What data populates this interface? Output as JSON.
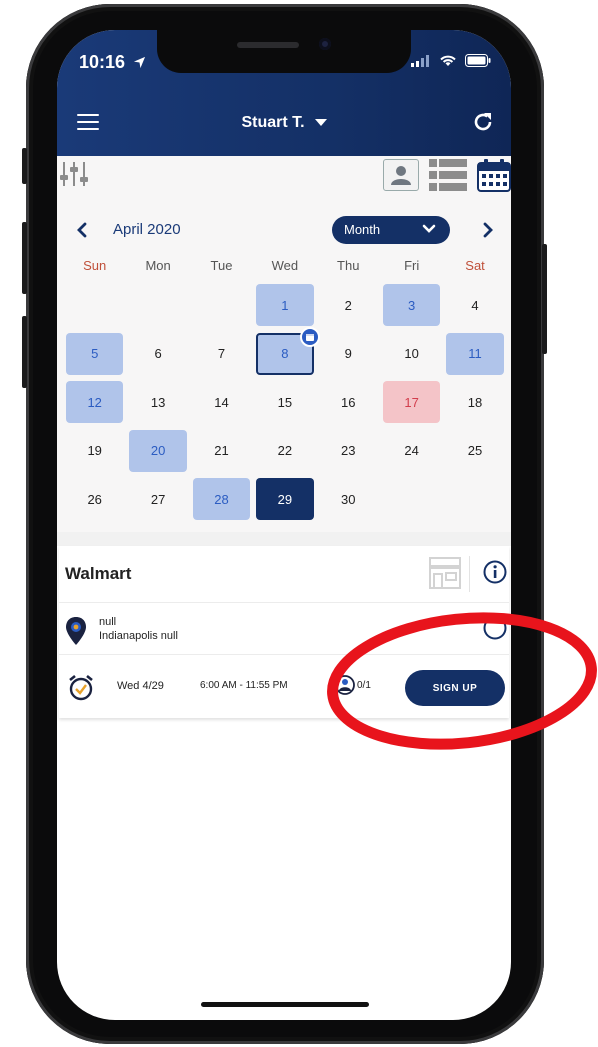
{
  "status_bar": {
    "time": "10:16"
  },
  "header": {
    "user_name": "Stuart T."
  },
  "calendar": {
    "month_label": "April 2020",
    "view_select": "Month",
    "weekdays": [
      "Sun",
      "Mon",
      "Tue",
      "Wed",
      "Thu",
      "Fri",
      "Sat"
    ],
    "weeks": [
      [
        {
          "d": ""
        },
        {
          "d": ""
        },
        {
          "d": ""
        },
        {
          "d": "1",
          "s": "event"
        },
        {
          "d": "2"
        },
        {
          "d": "3",
          "s": "event"
        },
        {
          "d": "4"
        }
      ],
      [
        {
          "d": "5",
          "s": "event"
        },
        {
          "d": "6"
        },
        {
          "d": "7"
        },
        {
          "d": "8",
          "s": "today"
        },
        {
          "d": "9"
        },
        {
          "d": "10"
        },
        {
          "d": "11",
          "s": "event"
        }
      ],
      [
        {
          "d": "12",
          "s": "event"
        },
        {
          "d": "13"
        },
        {
          "d": "14"
        },
        {
          "d": "15"
        },
        {
          "d": "16"
        },
        {
          "d": "17",
          "s": "holiday"
        },
        {
          "d": "18"
        }
      ],
      [
        {
          "d": "19"
        },
        {
          "d": "20",
          "s": "event"
        },
        {
          "d": "21"
        },
        {
          "d": "22"
        },
        {
          "d": "23"
        },
        {
          "d": "24"
        },
        {
          "d": "25"
        }
      ],
      [
        {
          "d": "26"
        },
        {
          "d": "27"
        },
        {
          "d": "28",
          "s": "event"
        },
        {
          "d": "29",
          "s": "selected"
        },
        {
          "d": "30"
        },
        {
          "d": ""
        },
        {
          "d": ""
        }
      ]
    ]
  },
  "event": {
    "title": "Walmart",
    "address_line1": "null",
    "address_line2": "Indianapolis null",
    "shift_day": "Wed 4/29",
    "shift_time": "6:00 AM - 11:55 PM",
    "slots": "0/1",
    "signup_label": "SIGN UP"
  },
  "colors": {
    "brand_navy": "#143066",
    "event_day": "#b0c4ea",
    "holiday_day": "#f4c4c8",
    "annotation_red": "#e8141c"
  }
}
